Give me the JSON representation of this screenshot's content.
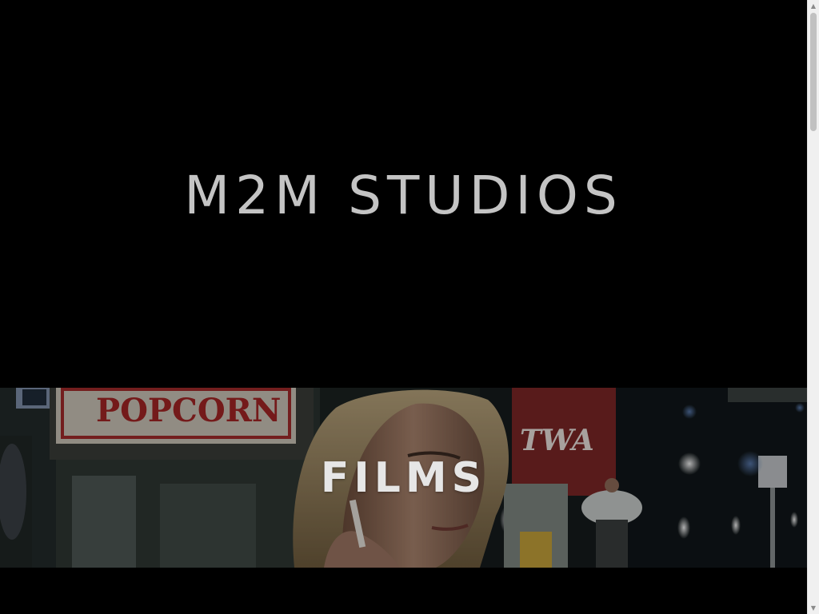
{
  "hero": {
    "title": "M2M STUDIOS"
  },
  "films_section": {
    "label": "FILMS",
    "photo": {
      "sign_popcorn": "POPCORN",
      "sign_twa": "TWA"
    }
  },
  "scrollbar": {
    "up_icon": "triangle-up-icon",
    "down_icon": "triangle-down-icon"
  },
  "colors": {
    "background": "#000000",
    "title_text": "#c4c4c4",
    "banner_text": "#e6e6e6"
  }
}
